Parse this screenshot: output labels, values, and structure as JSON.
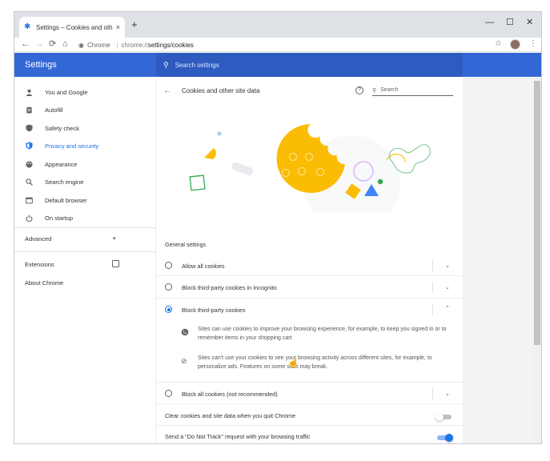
{
  "tab": {
    "title": "Settings – Cookies and other site",
    "close": "×",
    "new_tab": "+"
  },
  "window_controls": {
    "minimize": "—",
    "maximize": "☐",
    "close": "✕"
  },
  "toolbar": {
    "back": "←",
    "forward": "→",
    "reload": "⟳",
    "home": "⌂",
    "chip": "Chrome",
    "url_scheme": "chrome://",
    "url_path": "settings/cookies",
    "star": "☆",
    "menu": "⋮"
  },
  "header": {
    "brand": "Settings",
    "search_placeholder": "Search settings"
  },
  "sidebar": {
    "items": [
      {
        "label": "You and Google",
        "icon": "person-icon"
      },
      {
        "label": "Autofill",
        "icon": "clipboard-icon"
      },
      {
        "label": "Safety check",
        "icon": "shield-check-icon"
      },
      {
        "label": "Privacy and security",
        "icon": "shield-icon",
        "active": true
      },
      {
        "label": "Appearance",
        "icon": "palette-icon"
      },
      {
        "label": "Search engine",
        "icon": "search-icon"
      },
      {
        "label": "Default browser",
        "icon": "browser-icon"
      },
      {
        "label": "On startup",
        "icon": "power-icon"
      }
    ],
    "advanced": "Advanced",
    "extensions": "Extensions",
    "about": "About Chrome"
  },
  "page": {
    "title": "Cookies and other site data",
    "search_placeholder": "Search",
    "section": "General settings",
    "options": [
      {
        "label": "Allow all cookies",
        "selected": false
      },
      {
        "label": "Block third-party cookies in Incognito",
        "selected": false
      },
      {
        "label": "Block third-party cookies",
        "selected": true
      },
      {
        "label": "Block all cookies (not recommended)",
        "selected": false
      }
    ],
    "details": [
      "Sites can use cookies to improve your browsing experience, for example, to keep you signed in or to remember items in your shopping cart",
      "Sites can't use your cookies to see your browsing activity across different sites, for example, to personalize ads. Features on some sites may break."
    ],
    "clear_on_quit": {
      "label": "Clear cookies and site data when you quit Chrome",
      "on": false
    },
    "do_not_track": {
      "label": "Send a \"Do Not Track\" request with your browsing traffic",
      "on": true
    }
  },
  "colors": {
    "header_blue": "#3367d6",
    "accent": "#1a73e8",
    "cookie_yellow": "#fbbc04"
  }
}
